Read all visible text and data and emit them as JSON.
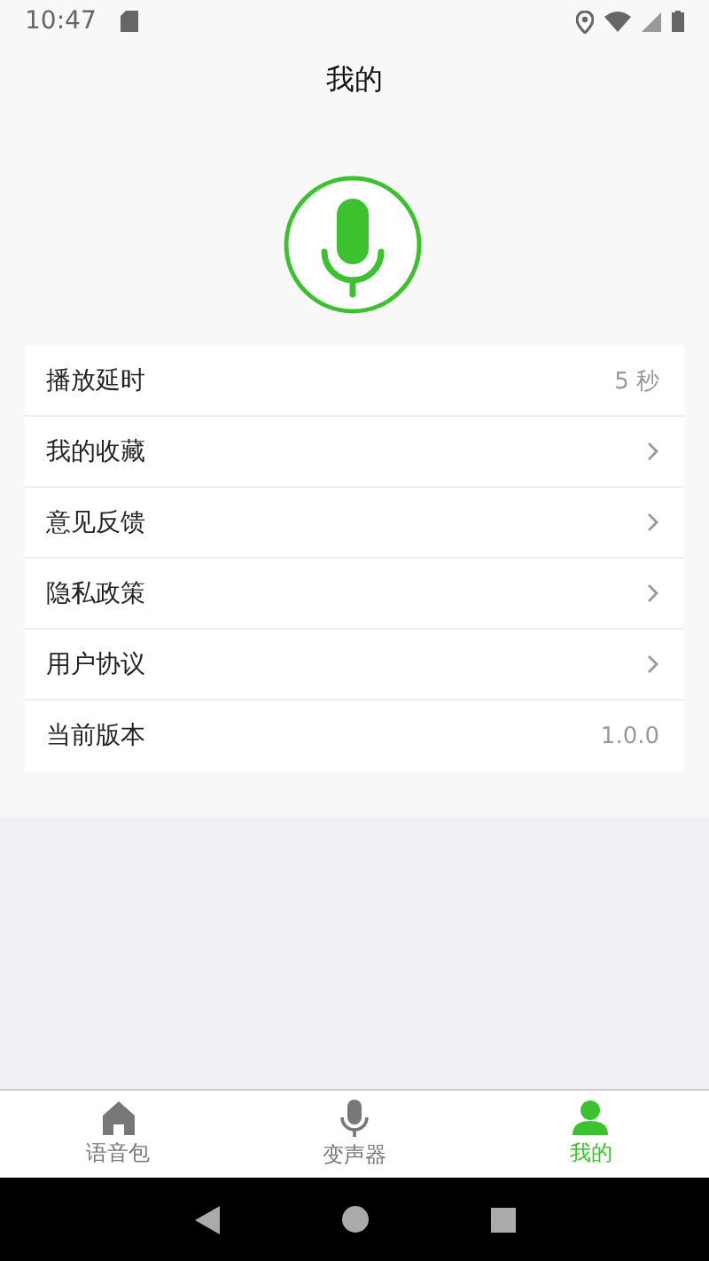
{
  "status_bar": {
    "time": "10:47"
  },
  "header": {
    "title": "我的"
  },
  "settings": [
    {
      "label": "播放延时",
      "kind": "value",
      "value": "5 秒"
    },
    {
      "label": "我的收藏",
      "kind": "link"
    },
    {
      "label": "意见反馈",
      "kind": "link"
    },
    {
      "label": "隐私政策",
      "kind": "link"
    },
    {
      "label": "用户协议",
      "kind": "link"
    },
    {
      "label": "当前版本",
      "kind": "value",
      "value": "1.0.0"
    }
  ],
  "tabs": [
    {
      "label": "语音包",
      "kind": "home",
      "selected": false
    },
    {
      "label": "变声器",
      "kind": "mic",
      "selected": false
    },
    {
      "label": "我的",
      "kind": "person",
      "selected": true
    }
  ]
}
